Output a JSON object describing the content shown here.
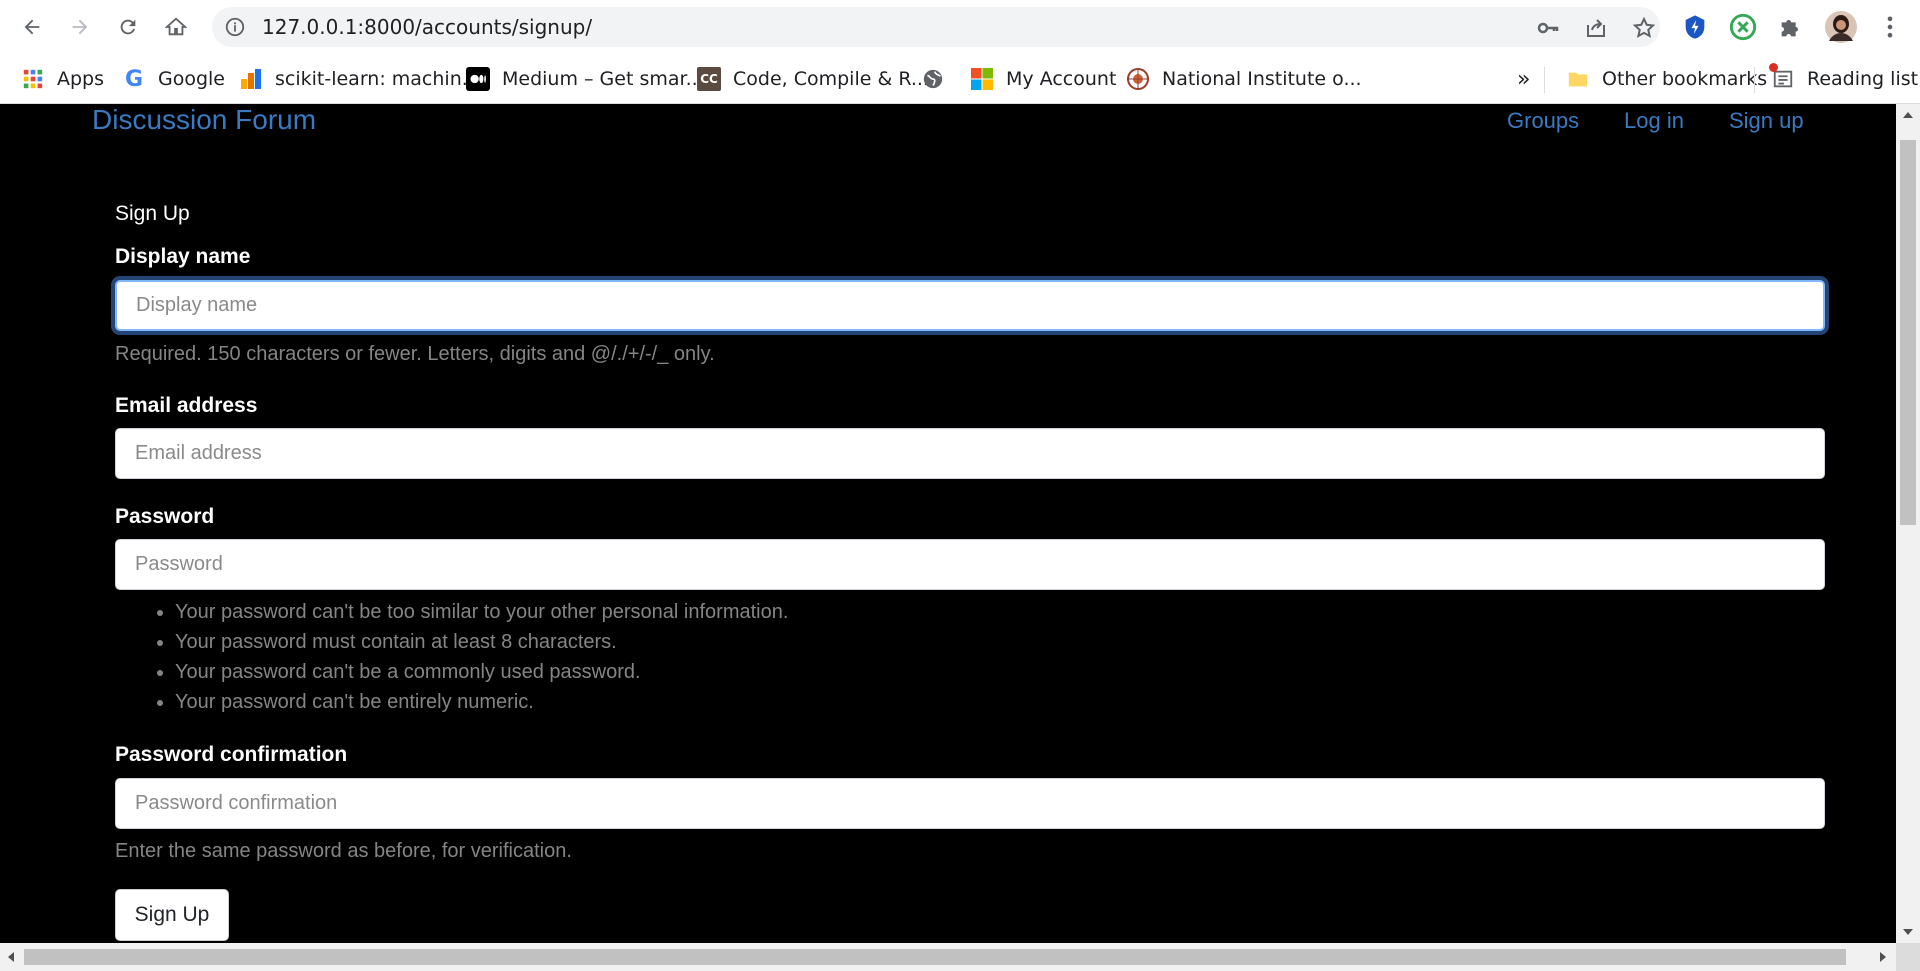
{
  "browser": {
    "url": "127.0.0.1:8000/accounts/signup/",
    "bookmarks": [
      {
        "label": "Apps",
        "icon": "apps-grid-icon"
      },
      {
        "label": "Google",
        "icon": "google-icon"
      },
      {
        "label": "scikit-learn: machin...",
        "icon": "chart-icon"
      },
      {
        "label": "Medium – Get smar...",
        "icon": "medium-icon"
      },
      {
        "label": "Code, Compile & R...",
        "icon": "cc-icon"
      },
      {
        "label": "",
        "icon": "globe-icon"
      },
      {
        "label": "My Account",
        "icon": "microsoft-icon"
      },
      {
        "label": "National Institute o...",
        "icon": "institute-icon"
      }
    ],
    "overflow": "»",
    "other_bookmarks": "Other bookmarks",
    "reading_list": "Reading list"
  },
  "site": {
    "brand": "Discussion Forum",
    "nav": [
      "Groups",
      "Log in",
      "Sign up"
    ]
  },
  "form": {
    "title": "Sign Up",
    "display_name": {
      "label": "Display name",
      "placeholder": "Display name",
      "help": "Required. 150 characters or fewer. Letters, digits and @/./+/-/_ only."
    },
    "email": {
      "label": "Email address",
      "placeholder": "Email address"
    },
    "password": {
      "label": "Password",
      "placeholder": "Password",
      "rules": [
        "Your password can't be too similar to your other personal information.",
        "Your password must contain at least 8 characters.",
        "Your password can't be a commonly used password.",
        "Your password can't be entirely numeric."
      ]
    },
    "password_confirmation": {
      "label": "Password confirmation",
      "placeholder": "Password confirmation",
      "help": "Enter the same password as before, for verification."
    },
    "submit": "Sign Up"
  },
  "colors": {
    "page_bg": "#000000",
    "link": "#3a7ac0",
    "help_text": "#858585"
  }
}
